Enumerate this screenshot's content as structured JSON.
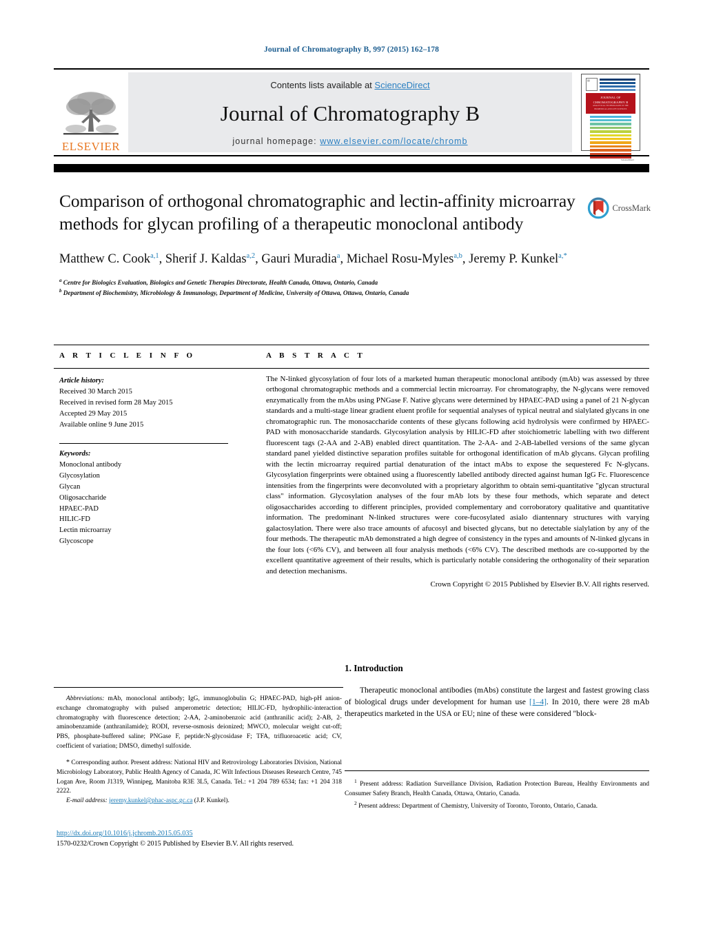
{
  "running_head": "Journal of Chromatography B, 997 (2015) 162–178",
  "masthead": {
    "contents_prefix": "Contents lists available at ",
    "contents_link": "ScienceDirect",
    "journal_title": "Journal of Chromatography B",
    "homepage_prefix": "journal homepage: ",
    "homepage_url": "www.elsevier.com/locate/chromb",
    "publisher": "ELSEVIER",
    "cover_band_title": "JOURNAL OF CHROMATOGRAPHY B",
    "cover_band_sub": "ANALYTICAL TECHNOLOGIES IN THE BIOMEDICAL AND LIFE SCIENCES",
    "cover_footer": "ScienceDirect",
    "link_color": "#2a7fc1",
    "elsevier_orange": "#E87722",
    "cover_red": "#b5121b"
  },
  "article": {
    "title": "Comparison of orthogonal chromatographic and lectin-affinity microarray methods for glycan profiling of a therapeutic monoclonal antibody",
    "crossmark_label": "CrossMark",
    "authors_html": "Matthew C. Cook<sup>a,1</sup>, Sherif J. Kaldas<sup>a,2</sup>, Gauri Muradia<sup>a</sup>, Michael Rosu-Myles<sup>a,b</sup>, Jeremy P. Kunkel<sup>a,*</sup>",
    "affiliations": [
      {
        "marker": "a",
        "text": "Centre for Biologics Evaluation, Biologics and Genetic Therapies Directorate, Health Canada, Ottawa, Ontario, Canada"
      },
      {
        "marker": "b",
        "text": "Department of Biochemistry, Microbiology & Immunology, Department of Medicine, University of Ottawa, Ottawa, Ontario, Canada"
      }
    ]
  },
  "info": {
    "heading": "A R T I C L E    I N F O",
    "history_title": "Article history:",
    "history": [
      "Received 30 March 2015",
      "Received in revised form 28 May 2015",
      "Accepted 29 May 2015",
      "Available online 9 June 2015"
    ],
    "keywords_title": "Keywords:",
    "keywords": [
      "Monoclonal antibody",
      "Glycosylation",
      "Glycan",
      "Oligosaccharide",
      "HPAEC-PAD",
      "HILIC-FD",
      "Lectin microarray",
      "Glycoscope"
    ]
  },
  "abstract": {
    "heading": "A B S T R A C T",
    "body": "The N-linked glycosylation of four lots of a marketed human therapeutic monoclonal antibody (mAb) was assessed by three orthogonal chromatographic methods and a commercial lectin microarray. For chromatography, the N-glycans were removed enzymatically from the mAbs using PNGase F. Native glycans were determined by HPAEC-PAD using a panel of 21 N-glycan standards and a multi-stage linear gradient eluent profile for sequential analyses of typical neutral and sialylated glycans in one chromatographic run. The monosaccharide contents of these glycans following acid hydrolysis were confirmed by HPAEC-PAD with monosaccharide standards. Glycosylation analysis by HILIC-FD after stoichiometric labelling with two different fluorescent tags (2-AA and 2-AB) enabled direct quantitation. The 2-AA- and 2-AB-labelled versions of the same glycan standard panel yielded distinctive separation profiles suitable for orthogonal identification of mAb glycans. Glycan profiling with the lectin microarray required partial denaturation of the intact mAbs to expose the sequestered Fc N-glycans. Glycosylation fingerprints were obtained using a fluorescently labelled antibody directed against human IgG Fc. Fluorescence intensities from the fingerprints were deconvoluted with a proprietary algorithm to obtain semi-quantitative \"glycan structural class\" information. Glycosylation analyses of the four mAb lots by these four methods, which separate and detect oligosaccharides according to different principles, provided complementary and corroboratory qualitative and quantitative information. The predominant N-linked structures were core-fucosylated asialo diantennary structures with varying galactosylation. There were also trace amounts of afucosyl and bisected glycans, but no detectable sialylation by any of the four methods. The therapeutic mAb demonstrated a high degree of consistency in the types and amounts of N-linked glycans in the four lots (<6% CV), and between all four analysis methods (<6% CV). The described methods are co-supported by the excellent quantitative agreement of their results, which is particularly notable considering the orthogonality of their separation and detection mechanisms.",
    "copyright": "Crown Copyright © 2015 Published by Elsevier B.V. All rights reserved."
  },
  "footnotes": {
    "abbreviations_label": "Abbreviations:",
    "abbreviations_text": " mAb, monoclonal antibody; IgG, immunoglobulin G; HPAEC-PAD, high-pH anion-exchange chromatography with pulsed amperometric detection; HILIC-FD, hydrophilic-interaction chromatography with fluorescence detection; 2-AA, 2-aminobenzoic acid (anthranilic acid); 2-AB, 2-aminobenzamide (anthranilamide); RODI, reverse-osmosis deionized; MWCO, molecular weight cut-off; PBS, phosphate-buffered saline; PNGase F, peptide:N-glycosidase F; TFA, trifluoroacetic acid; CV, coefficient of variation; DMSO, dimethyl sulfoxide.",
    "corresponding_star": "*",
    "corresponding_text": " Corresponding author. Present address: National HIV and Retrovirology Laboratories Division, National Microbiology Laboratory, Public Health Agency of Canada, JC Wilt Infectious Diseases Research Centre, 745 Logan Ave, Room J1319, Winnipeg, Manitoba R3E 3L5, Canada. Tel.: +1 204 789 6534; fax: +1 204 318 2222.",
    "email_label": "E-mail address:",
    "email": "jeremy.kunkel@phac-aspc.gc.ca",
    "email_suffix": " (J.P. Kunkel).",
    "present_address_1": " Present address: Radiation Surveillance Division, Radiation Protection Bureau, Healthy Environments and Consumer Safety Branch, Health Canada, Ottawa, Ontario, Canada.",
    "present_address_2": " Present address: Department of Chemistry, University of Toronto, Toronto, Ontario, Canada."
  },
  "doi": {
    "url": "http://dx.doi.org/10.1016/j.jchromb.2015.05.035",
    "issn_line": "1570-0232/Crown Copyright © 2015 Published by Elsevier B.V. All rights reserved."
  },
  "introduction": {
    "heading": "1.  Introduction",
    "paragraph_pre": "Therapeutic monoclonal antibodies (mAbs) constitute the largest and fastest growing class of biological drugs under development for human use ",
    "reference": "[1–4]",
    "paragraph_post": ". In 2010, there were 28 mAb therapeutics marketed in the USA or EU; nine of these were considered \"block-"
  }
}
